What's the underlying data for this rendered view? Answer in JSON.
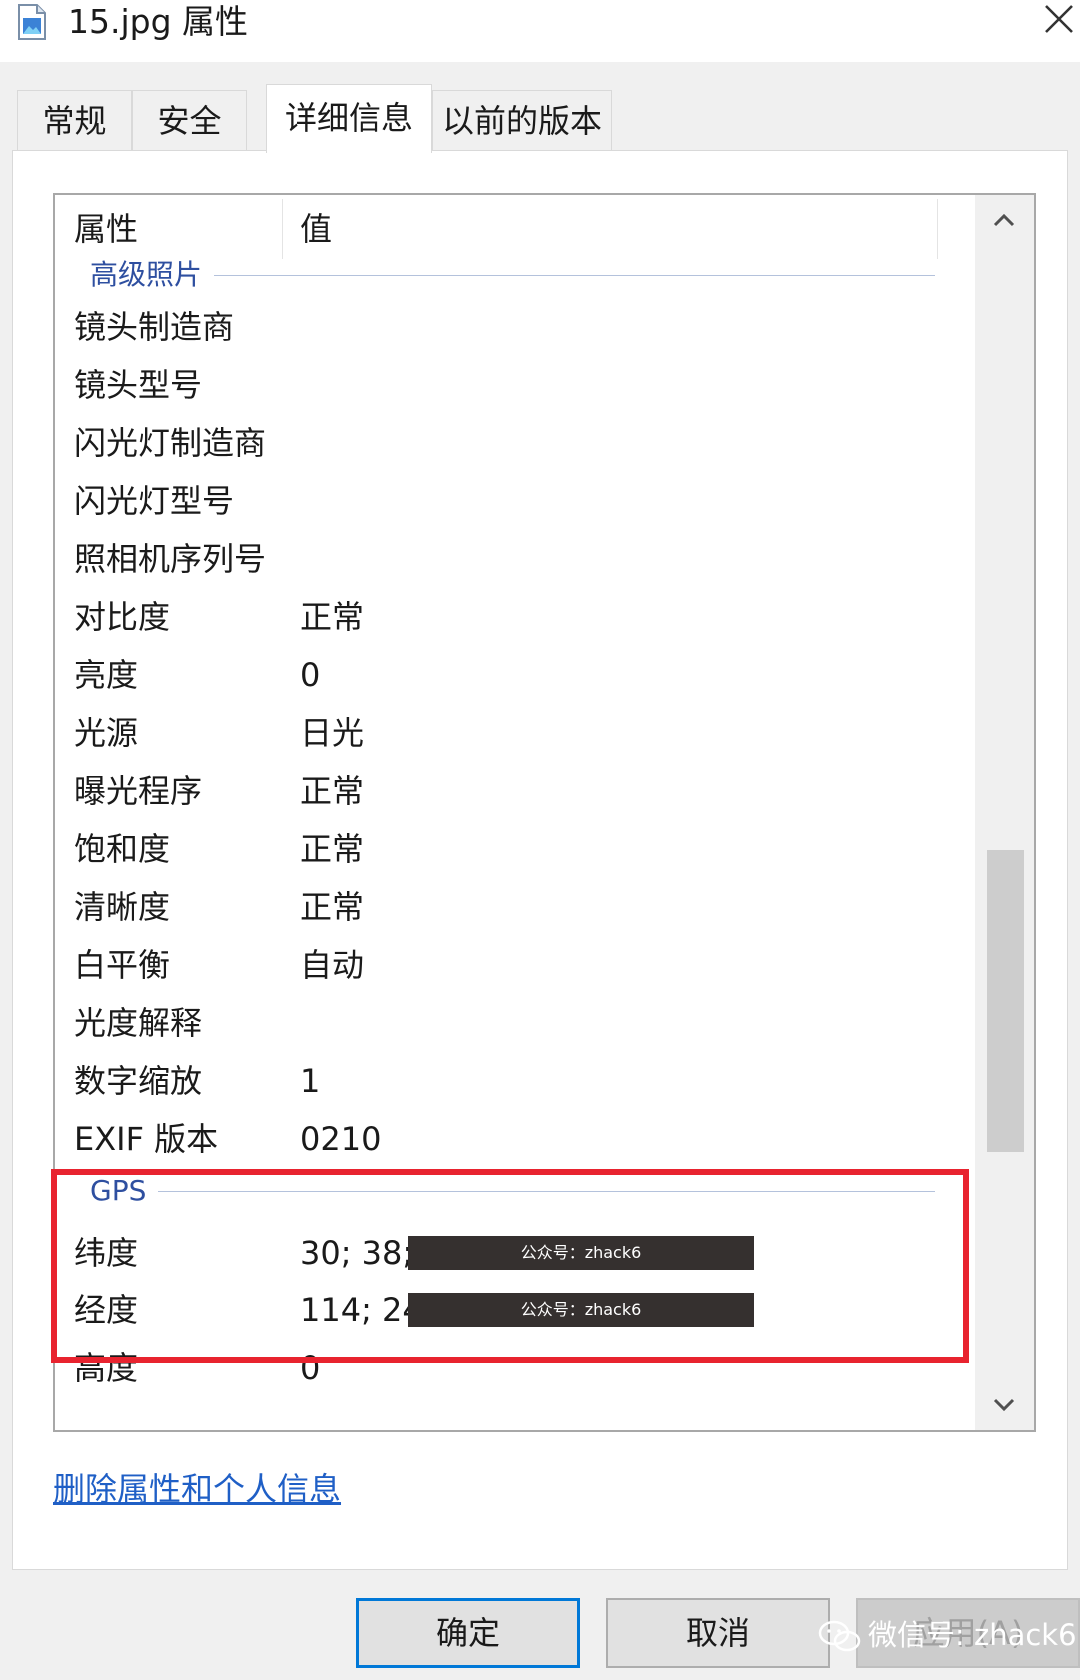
{
  "window": {
    "title": "15.jpg 属性"
  },
  "tabs": [
    {
      "label": "常规",
      "active": false
    },
    {
      "label": "安全",
      "active": false
    },
    {
      "label": "详细信息",
      "active": true
    },
    {
      "label": "以前的版本",
      "active": false
    }
  ],
  "list": {
    "header_property": "属性",
    "header_value": "值",
    "group_advanced": "高级照片",
    "rows_advanced": [
      {
        "name": "镜头制造商",
        "value": ""
      },
      {
        "name": "镜头型号",
        "value": ""
      },
      {
        "name": "闪光灯制造商",
        "value": ""
      },
      {
        "name": "闪光灯型号",
        "value": ""
      },
      {
        "name": "照相机序列号",
        "value": ""
      },
      {
        "name": "对比度",
        "value": "正常"
      },
      {
        "name": "亮度",
        "value": "0"
      },
      {
        "name": "光源",
        "value": "日光"
      },
      {
        "name": "曝光程序",
        "value": "正常"
      },
      {
        "name": "饱和度",
        "value": "正常"
      },
      {
        "name": "清晰度",
        "value": "正常"
      },
      {
        "name": "白平衡",
        "value": "自动"
      },
      {
        "name": "光度解释",
        "value": ""
      },
      {
        "name": "数字缩放",
        "value": "1"
      },
      {
        "name": "EXIF 版本",
        "value": "0210"
      }
    ],
    "group_gps": "GPS",
    "rows_gps": [
      {
        "name": "纬度",
        "value": "30; 38;",
        "redaction": "公众号：zhack6"
      },
      {
        "name": "经度",
        "value": "114; 24",
        "redaction": "公众号：zhack6"
      },
      {
        "name": "高度",
        "value": "0"
      }
    ]
  },
  "links": {
    "delete_properties": "删除属性和个人信息"
  },
  "buttons": {
    "ok": "确定",
    "cancel": "取消",
    "apply": "应用(A)"
  },
  "watermark": {
    "text": "微信号: zhack6"
  },
  "colors": {
    "highlight": "#e8232f",
    "link": "#1f5fc6",
    "group_header": "#2e4fa0",
    "primary_border": "#0078d7"
  }
}
